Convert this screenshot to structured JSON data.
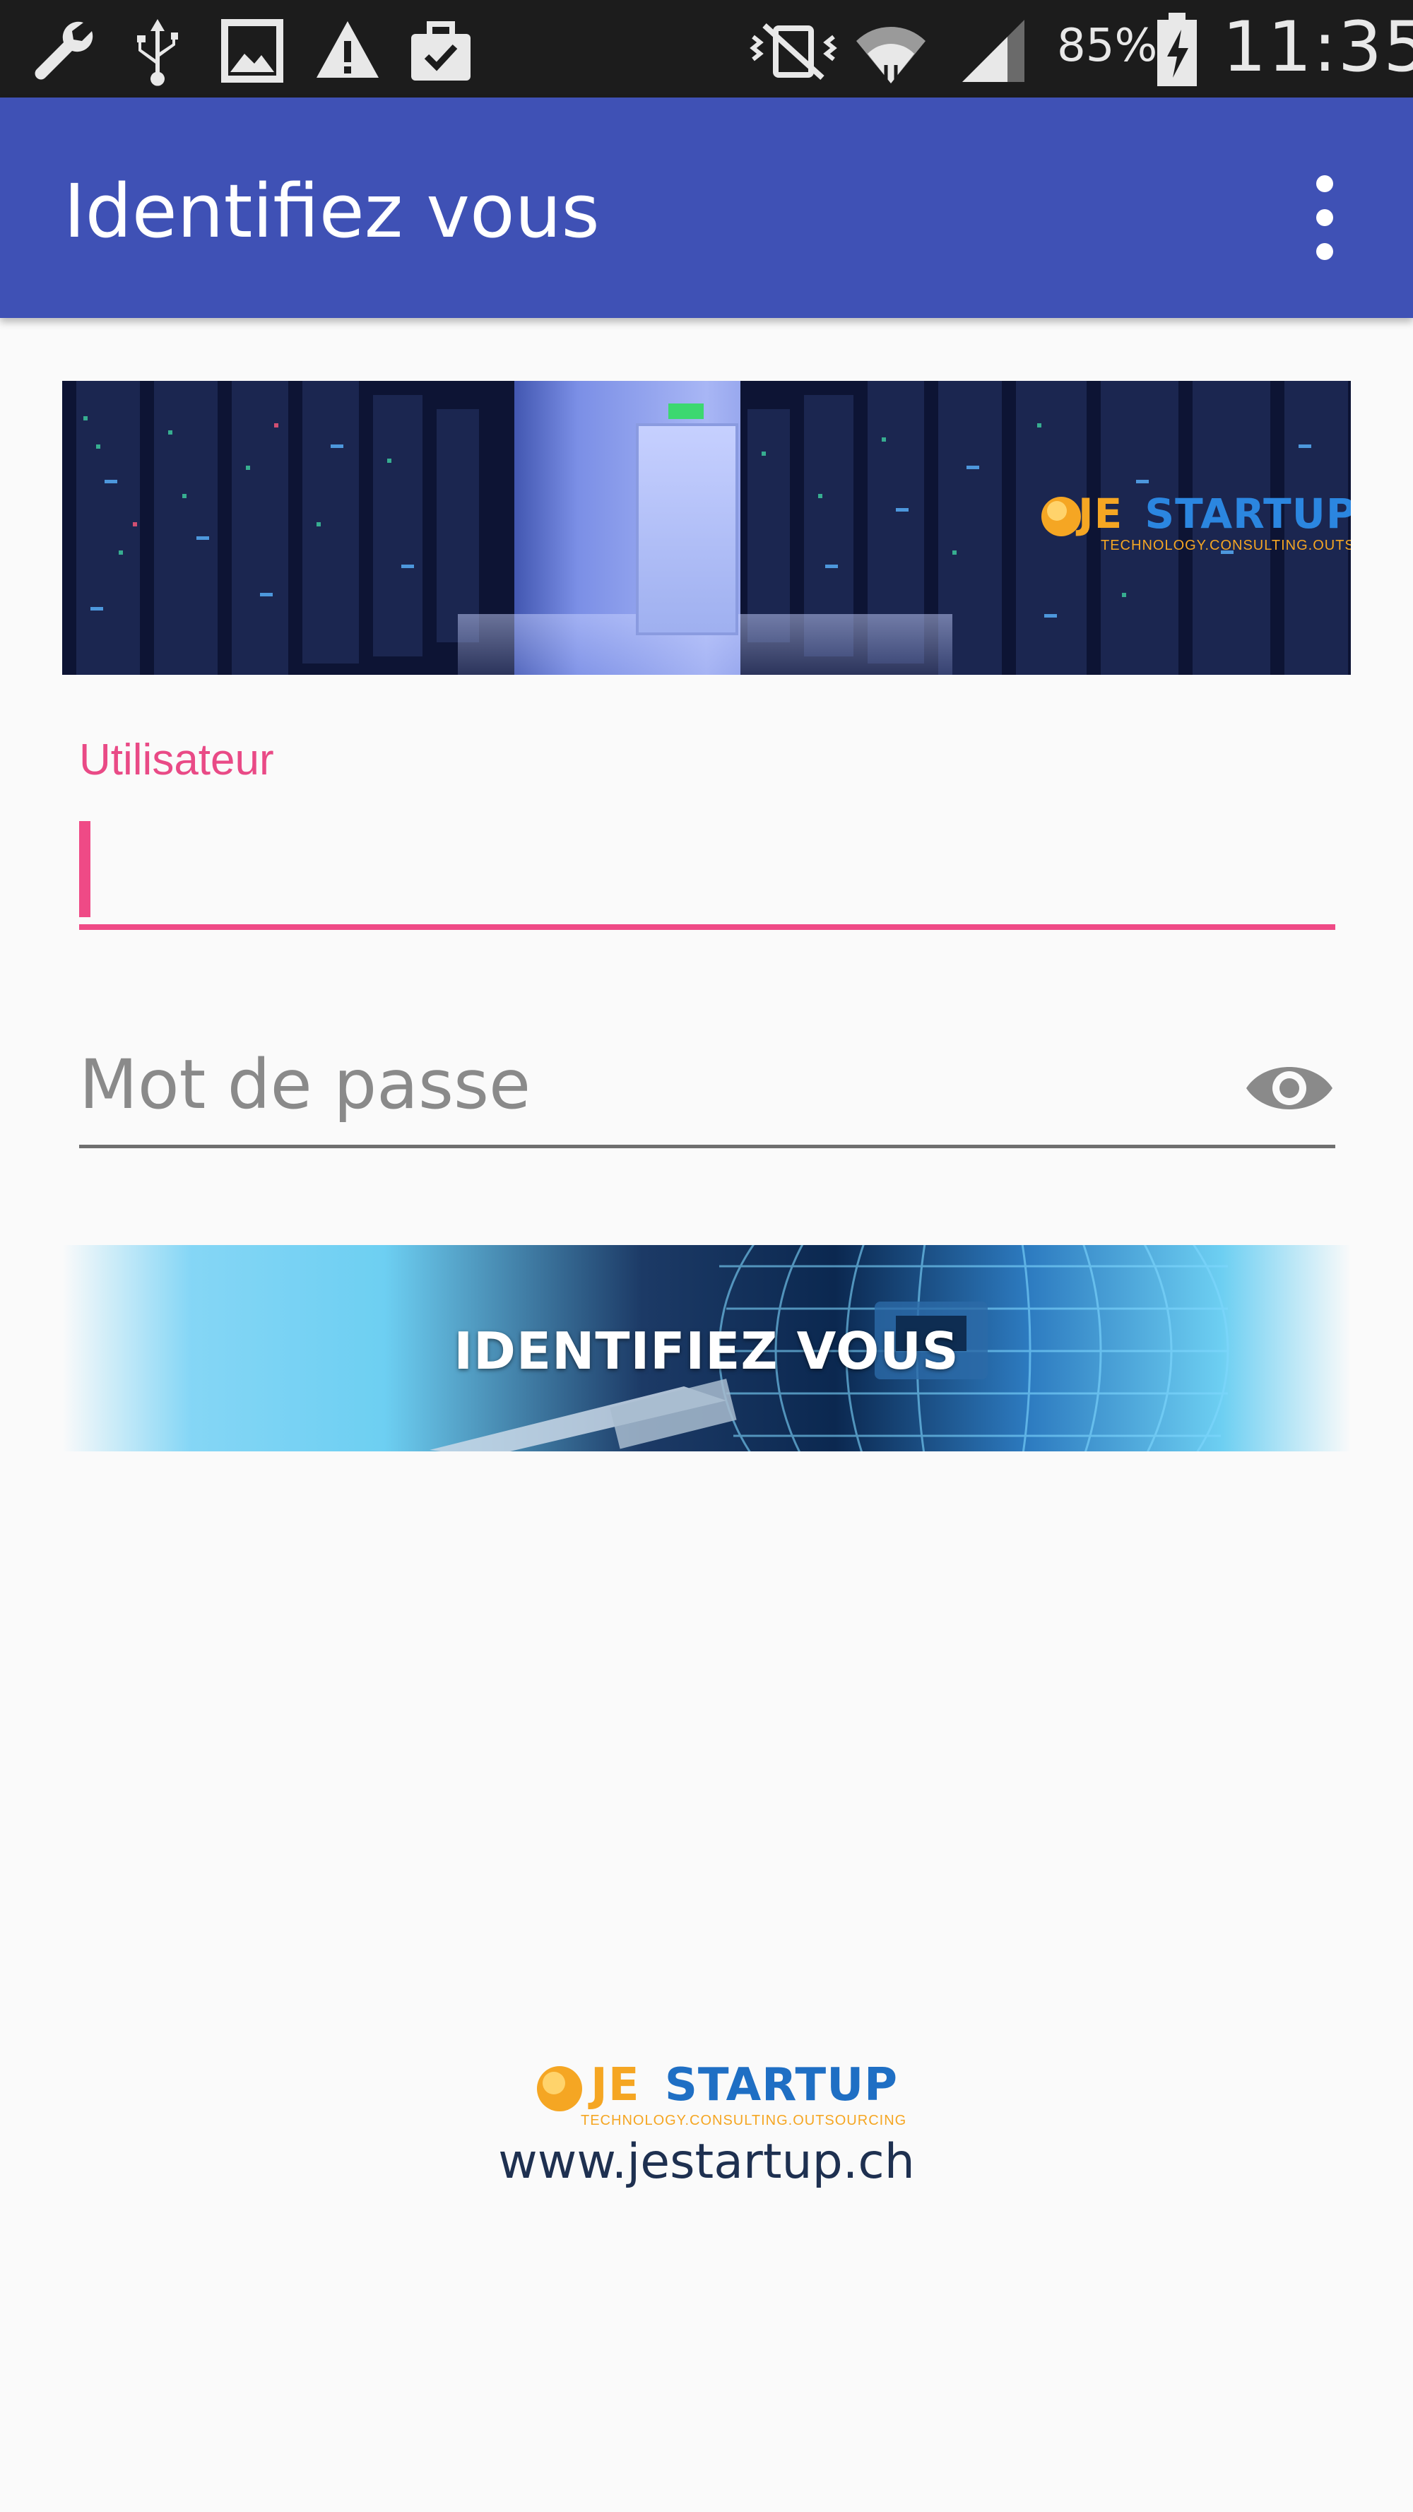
{
  "status_bar": {
    "battery_percent": "85%",
    "time": "11:35",
    "icons": [
      "wrench-icon",
      "usb-icon",
      "image-icon",
      "warning-icon",
      "briefcase-check-icon",
      "vibrate-icon",
      "wifi-icon",
      "signal-icon",
      "battery-charging-icon"
    ]
  },
  "toolbar": {
    "title": "Identifiez vous",
    "overflow_icon": "more-vertical-icon"
  },
  "banner": {
    "logo_je": "JE",
    "logo_startup": "STARTUP",
    "logo_tagline": "TECHNOLOGY.CONSULTING.OUTSOURCING"
  },
  "form": {
    "username": {
      "label": "Utilisateur",
      "value": ""
    },
    "password": {
      "placeholder": "Mot de passe",
      "value": "",
      "toggle_icon": "eye-icon"
    },
    "submit_label": "IDENTIFIEZ VOUS"
  },
  "footer": {
    "logo_je": "JE",
    "logo_startup": "STARTUP",
    "logo_tagline": "TECHNOLOGY.CONSULTING.OUTSOURCING",
    "url": "www.jestartup.ch"
  },
  "colors": {
    "toolbar": "#3f51b5",
    "accent": "#ef4a86",
    "background": "#fafafa",
    "status_bar": "#1c1c1c",
    "logo_orange": "#f5a623",
    "logo_blue": "#1f6fc4"
  }
}
